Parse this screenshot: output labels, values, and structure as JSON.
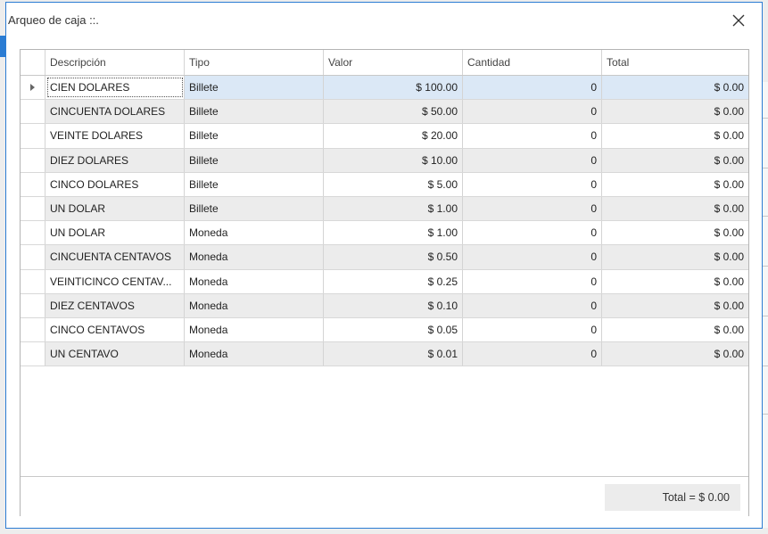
{
  "window": {
    "title": "Arqueo de caja ::."
  },
  "grid": {
    "columns": [
      "Descripción",
      "Tipo",
      "Valor",
      "Cantidad",
      "Total"
    ],
    "rows": [
      {
        "descripcion": "CIEN DOLARES",
        "tipo": "Billete",
        "valor": "$ 100.00",
        "cantidad": "0",
        "total": "$ 0.00"
      },
      {
        "descripcion": "CINCUENTA DOLARES",
        "tipo": "Billete",
        "valor": "$ 50.00",
        "cantidad": "0",
        "total": "$ 0.00"
      },
      {
        "descripcion": "VEINTE DOLARES",
        "tipo": "Billete",
        "valor": "$ 20.00",
        "cantidad": "0",
        "total": "$ 0.00"
      },
      {
        "descripcion": "DIEZ DOLARES",
        "tipo": "Billete",
        "valor": "$ 10.00",
        "cantidad": "0",
        "total": "$ 0.00"
      },
      {
        "descripcion": "CINCO DOLARES",
        "tipo": "Billete",
        "valor": "$ 5.00",
        "cantidad": "0",
        "total": "$ 0.00"
      },
      {
        "descripcion": "UN DOLAR",
        "tipo": "Billete",
        "valor": "$ 1.00",
        "cantidad": "0",
        "total": "$ 0.00"
      },
      {
        "descripcion": "UN DOLAR",
        "tipo": "Moneda",
        "valor": "$ 1.00",
        "cantidad": "0",
        "total": "$ 0.00"
      },
      {
        "descripcion": "CINCUENTA CENTAVOS",
        "tipo": "Moneda",
        "valor": "$ 0.50",
        "cantidad": "0",
        "total": "$ 0.00"
      },
      {
        "descripcion": "VEINTICINCO CENTAV...",
        "tipo": "Moneda",
        "valor": "$ 0.25",
        "cantidad": "0",
        "total": "$ 0.00"
      },
      {
        "descripcion": "DIEZ CENTAVOS",
        "tipo": "Moneda",
        "valor": "$ 0.10",
        "cantidad": "0",
        "total": "$ 0.00"
      },
      {
        "descripcion": "CINCO CENTAVOS",
        "tipo": "Moneda",
        "valor": "$ 0.05",
        "cantidad": "0",
        "total": "$ 0.00"
      },
      {
        "descripcion": "UN CENTAVO",
        "tipo": "Moneda",
        "valor": "$ 0.01",
        "cantidad": "0",
        "total": "$ 0.00"
      }
    ],
    "selected_row": 0
  },
  "footer": {
    "total_label": "Total = $ 0.00"
  },
  "colors": {
    "accent": "#2b7cd3",
    "selected_row": "#dbe8f6",
    "alt_row": "#ececec"
  },
  "icons": {
    "close": "close-icon",
    "row_indicator": "row-indicator-icon"
  }
}
